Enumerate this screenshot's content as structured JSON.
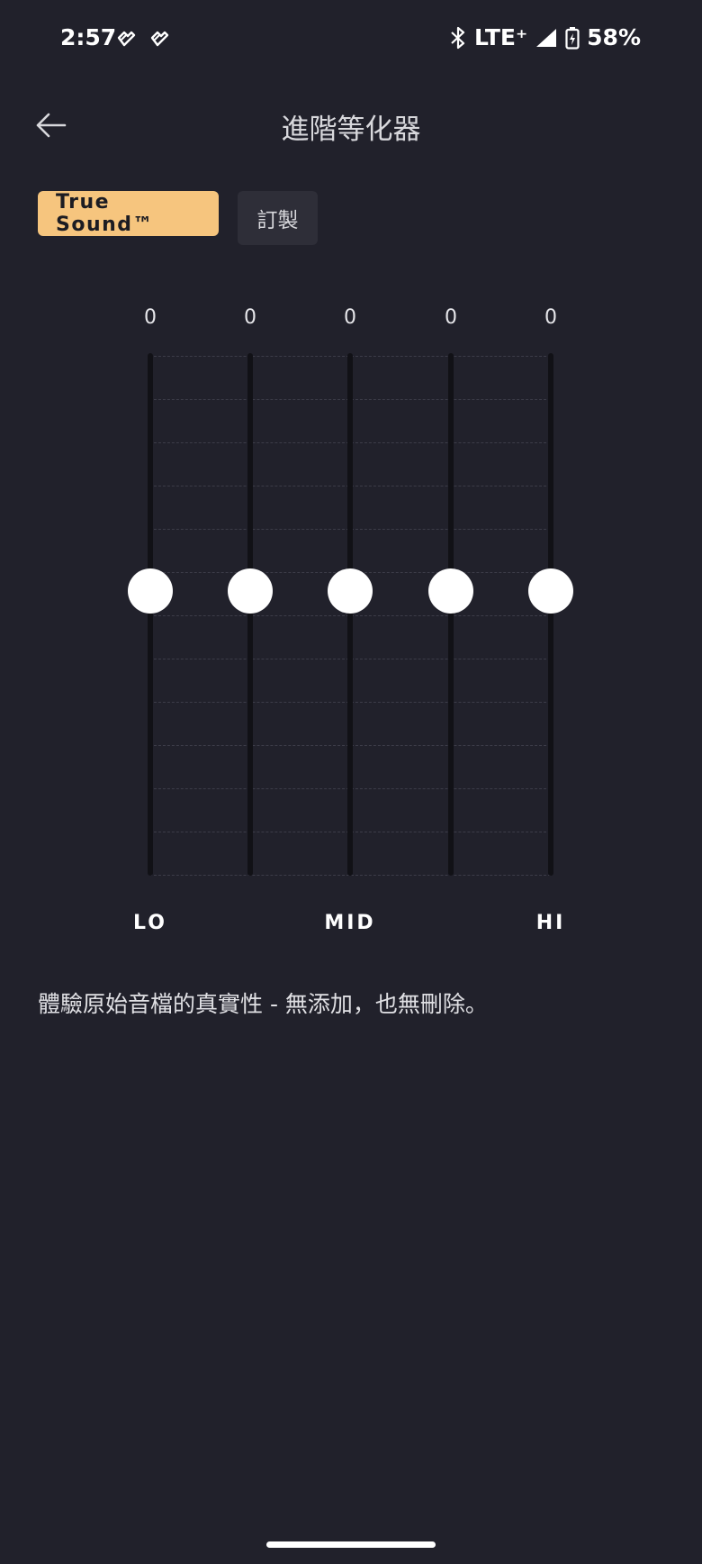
{
  "status_bar": {
    "time": "2:57",
    "network": "LTE⁺",
    "battery": "58%",
    "icons": [
      "notification-heart-icon",
      "notification-heart-icon",
      "bluetooth-icon",
      "signal-icon",
      "battery-charging-icon"
    ]
  },
  "header": {
    "back_icon": "arrow-left-icon",
    "title": "進階等化器"
  },
  "presets": {
    "active_label": "True Sound™",
    "custom_label": "訂製"
  },
  "equalizer": {
    "bands": [
      {
        "value": "0",
        "level": 0
      },
      {
        "value": "0",
        "level": 0
      },
      {
        "value": "0",
        "level": 0
      },
      {
        "value": "0",
        "level": 0
      },
      {
        "value": "0",
        "level": 0
      }
    ],
    "labels": {
      "lo": "LO",
      "mid": "MID",
      "hi": "HI"
    }
  },
  "description": "體驗原始音檔的真實性 - 無添加，也無刪除。",
  "colors": {
    "background": "#21212b",
    "accent": "#f6c57e",
    "chip_inactive": "#2e2e38",
    "knob": "#ffffff"
  }
}
